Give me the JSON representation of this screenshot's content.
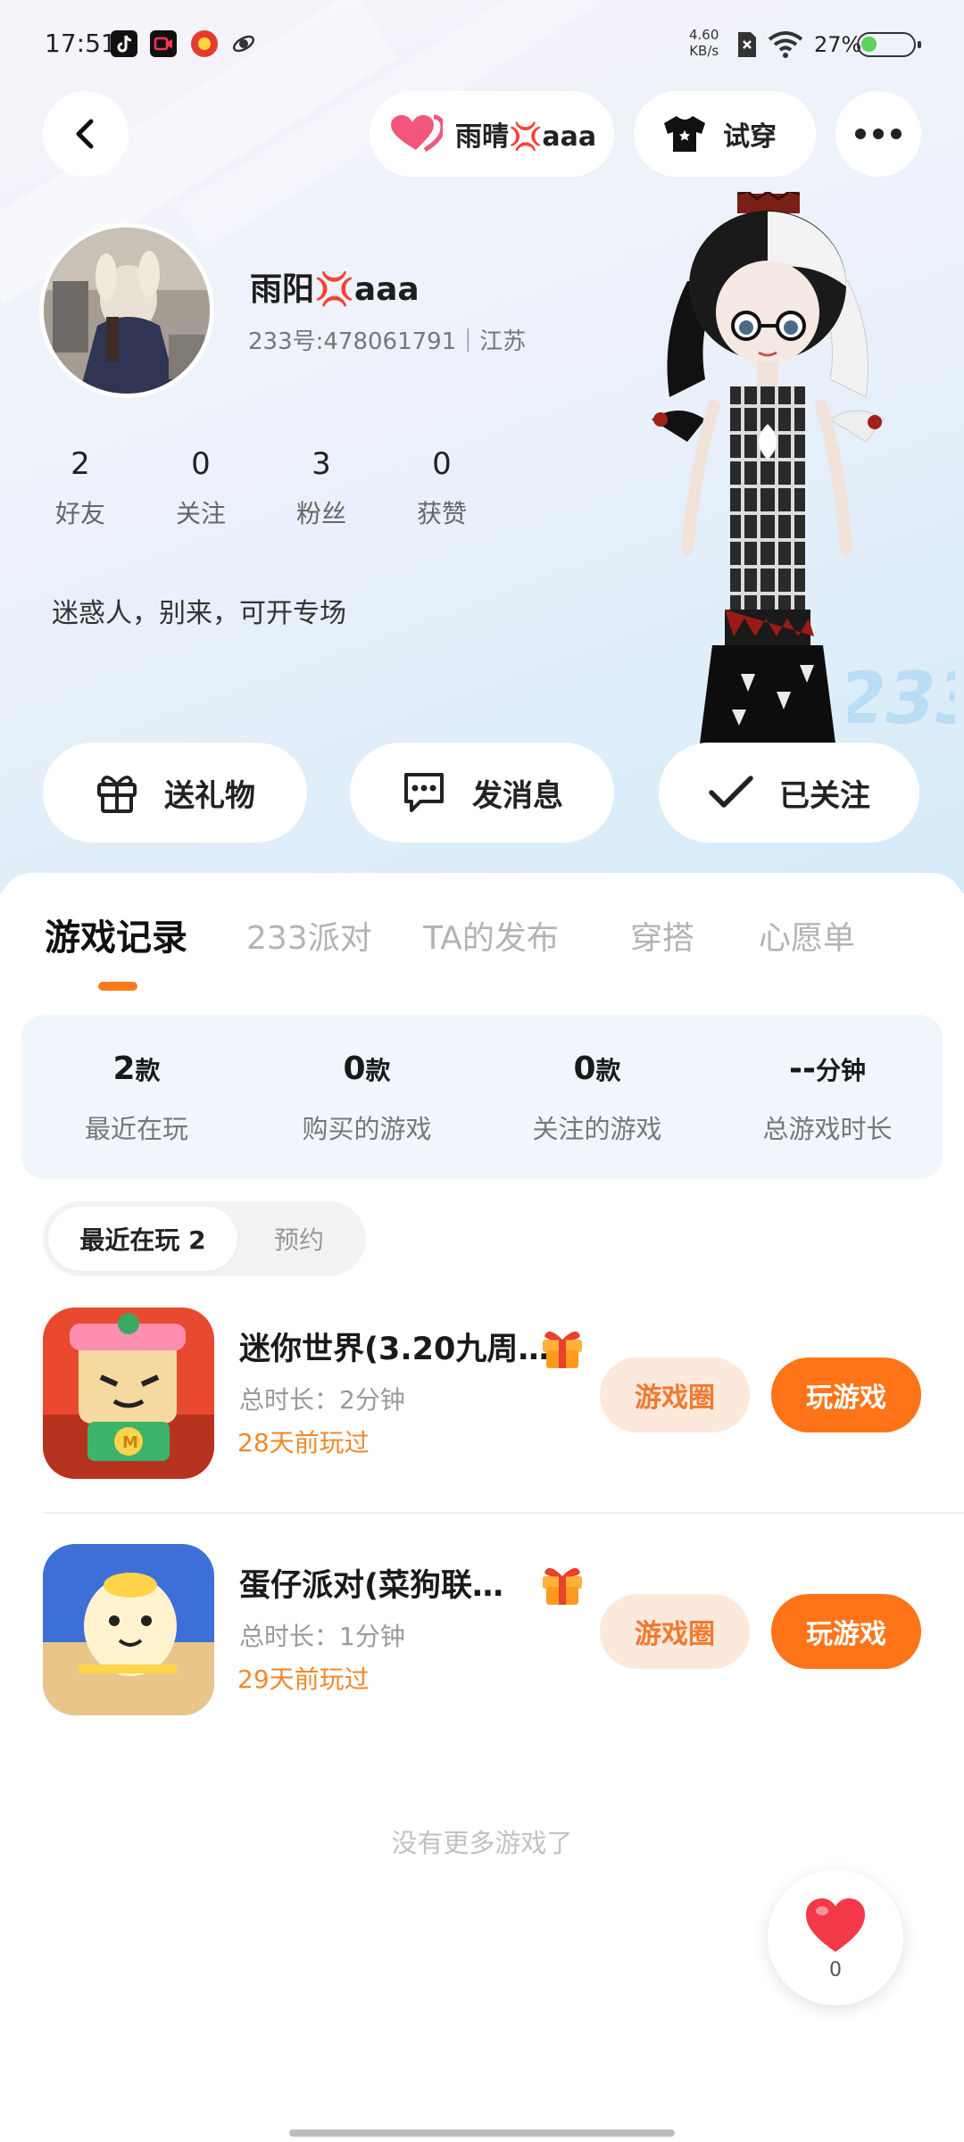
{
  "status_bar": {
    "time": "17:51",
    "net_speed_value": "4.60",
    "net_speed_unit": "KB/s",
    "battery": "27%"
  },
  "header": {
    "partner_name": "雨晴💢aaa",
    "try_on_label": "试穿"
  },
  "profile": {
    "name": "雨阳💢aaa",
    "id_line": "233号:478061791｜江苏",
    "bio": "迷惑人，别来，可开专场"
  },
  "stats": [
    {
      "num": "2",
      "label": "好友"
    },
    {
      "num": "0",
      "label": "关注"
    },
    {
      "num": "3",
      "label": "粉丝"
    },
    {
      "num": "0",
      "label": "获赞"
    }
  ],
  "actions": {
    "gift": "送礼物",
    "message": "发消息",
    "followed": "已关注"
  },
  "tabs": [
    "游戏记录",
    "233派对",
    "TA的发布",
    "穿搭",
    "心愿单"
  ],
  "active_tab": "游戏记录",
  "summary": [
    {
      "value": "2",
      "unit": "款",
      "label": "最近在玩"
    },
    {
      "value": "0",
      "unit": "款",
      "label": "购买的游戏"
    },
    {
      "value": "0",
      "unit": "款",
      "label": "关注的游戏"
    },
    {
      "value": "--",
      "unit": "分钟",
      "label": "总游戏时长"
    }
  ],
  "segment": {
    "recent": "最近在玩 2",
    "reserve": "预约"
  },
  "games": [
    {
      "title": "迷你世界(3.20九周…",
      "total": "总时长：2分钟",
      "ago": "28天前玩过",
      "circle_label": "游戏圈",
      "play_label": "玩游戏"
    },
    {
      "title": "蛋仔派对(菜狗联…",
      "total": "总时长：1分钟",
      "ago": "29天前玩过",
      "circle_label": "游戏圈",
      "play_label": "玩游戏"
    }
  ],
  "no_more": "没有更多游戏了",
  "like_count": "0",
  "colors": {
    "accent": "#ff7418",
    "accent_soft": "#fde8dc",
    "summary_bg": "#f1f6fd"
  }
}
